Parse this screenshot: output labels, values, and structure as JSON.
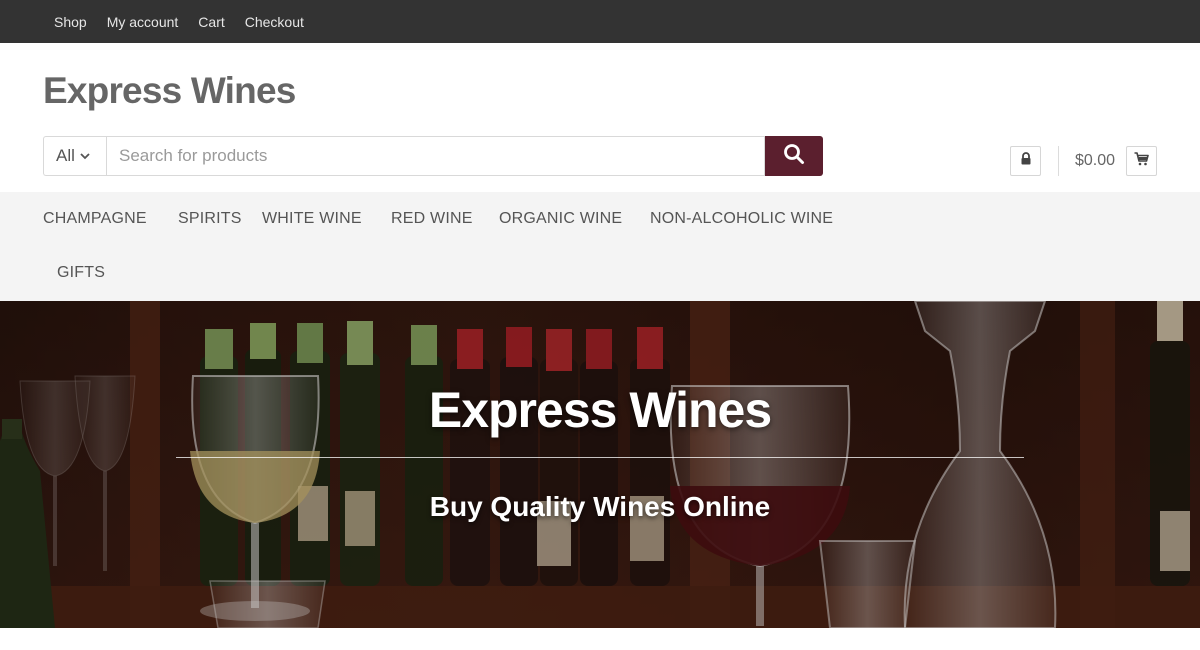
{
  "topbar": {
    "links": [
      "Shop",
      "My account",
      "Cart",
      "Checkout"
    ]
  },
  "header": {
    "site_title": "Express Wines",
    "search": {
      "category": "All",
      "placeholder": "Search for products",
      "value": ""
    },
    "cart_total": "$0.00"
  },
  "categories": [
    "CHAMPAGNE",
    "SPIRITS",
    "WHITE WINE",
    "RED WINE",
    "ORGANIC WINE",
    "NON-ALCOHOLIC WINE",
    "GIFTS"
  ],
  "hero": {
    "title": "Express Wines",
    "subtitle": "Buy Quality Wines Online"
  },
  "colors": {
    "topbar_bg": "#333333",
    "accent": "#5b1f2e",
    "nav_bg": "#f4f4f4",
    "title_text": "#666666"
  },
  "icons": [
    "chevron-down-icon",
    "search-icon",
    "lock-icon",
    "cart-icon"
  ]
}
